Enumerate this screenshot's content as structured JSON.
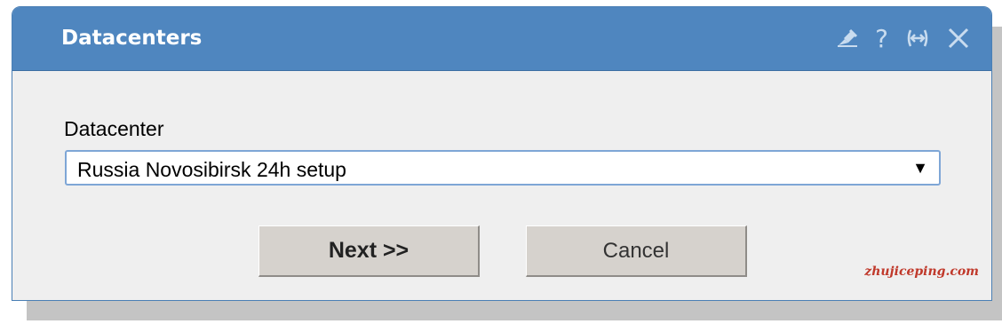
{
  "dialog": {
    "title": "Datacenters",
    "toolbar_icons": [
      "pin-icon",
      "help-icon",
      "expand-width-icon",
      "close-icon"
    ],
    "help_glyph": "?",
    "close_glyph": "✕"
  },
  "form": {
    "label": "Datacenter",
    "selected": "Russia Novosibirsk 24h setup",
    "arrow": "▼"
  },
  "buttons": {
    "next": "Next >>",
    "cancel": "Cancel"
  },
  "watermark": "zhujiceping.com",
  "colors": {
    "titlebar": "#4f86bf",
    "dialog_bg": "#efefef",
    "button_bg": "#d6d2cd",
    "select_border": "#7ea6d6",
    "watermark": "#c0392b"
  }
}
